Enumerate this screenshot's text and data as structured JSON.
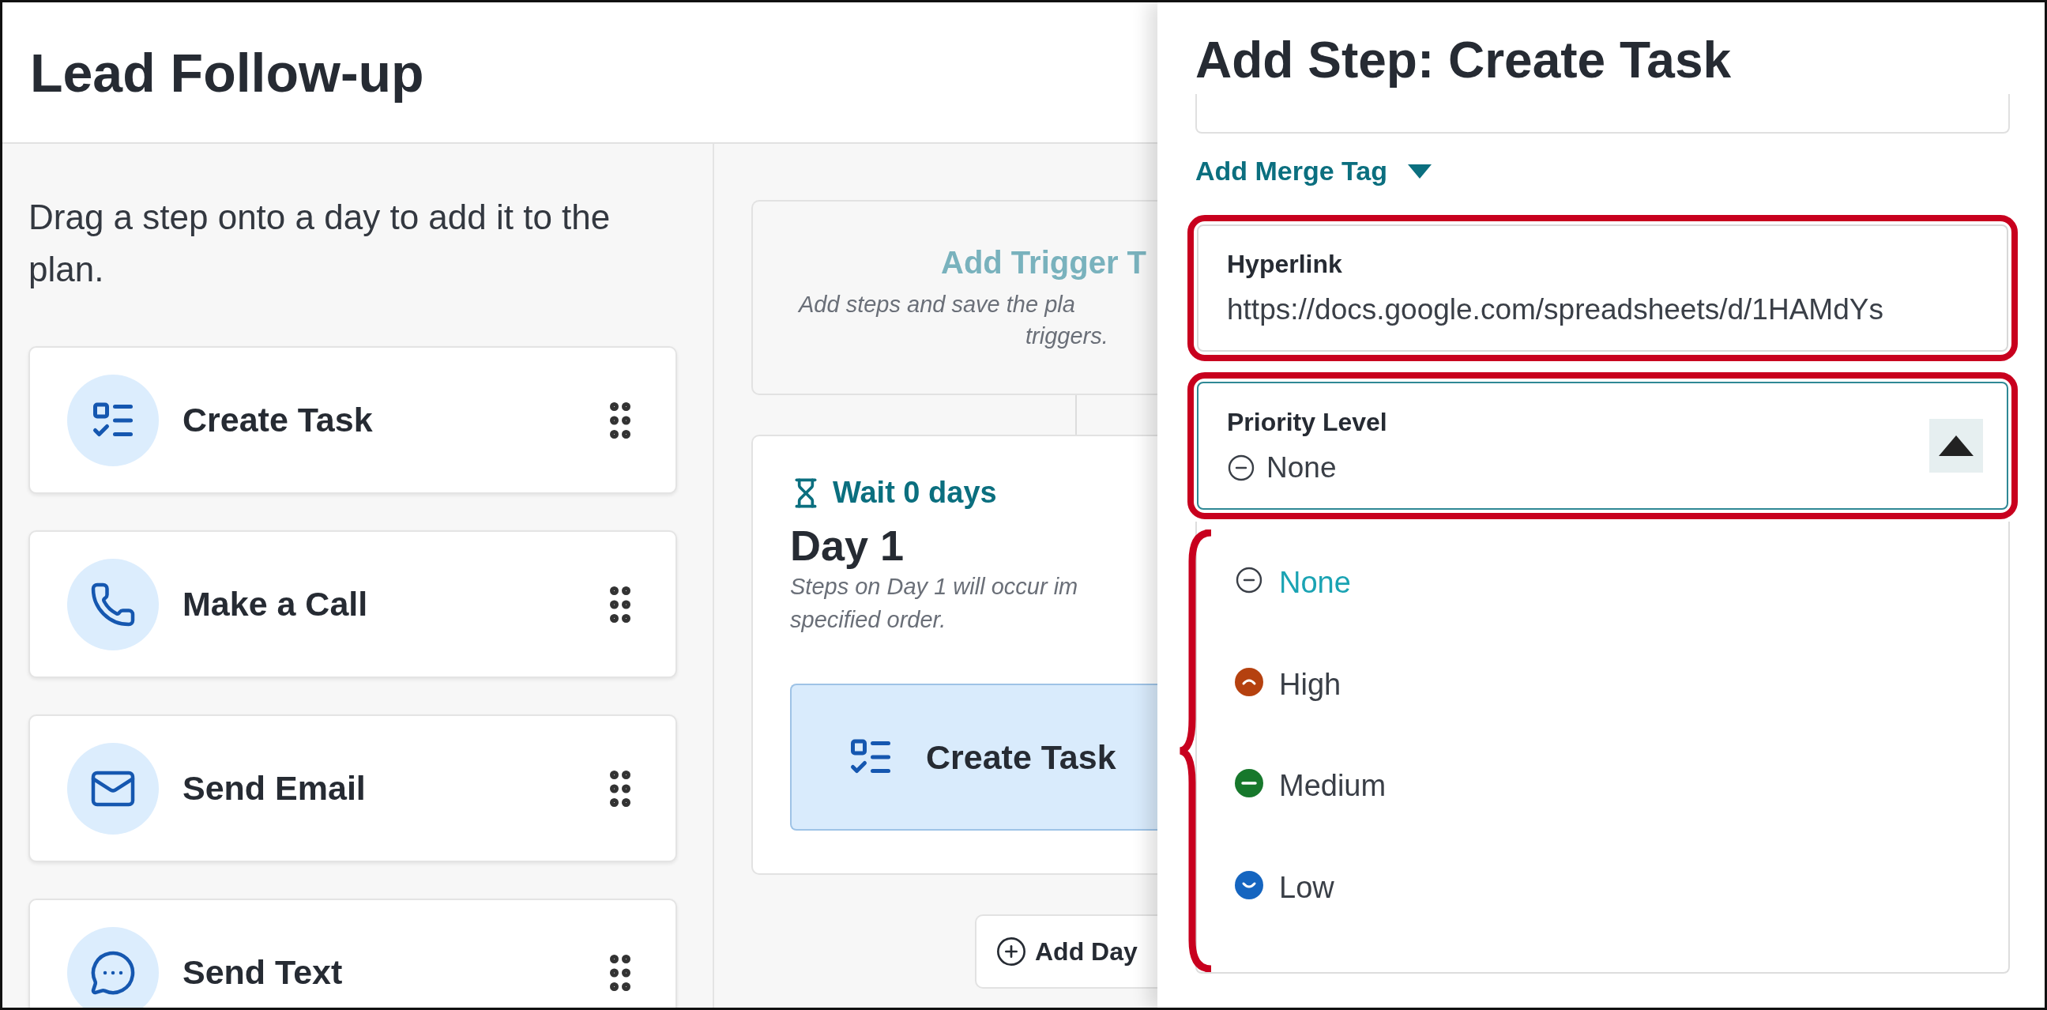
{
  "header": {
    "title": "Lead Follow-up"
  },
  "steps_panel": {
    "hint": "Drag a step onto a day to add it to the plan.",
    "steps": [
      {
        "label": "Create Task",
        "kind": "task"
      },
      {
        "label": "Make a Call",
        "kind": "call"
      },
      {
        "label": "Send Email",
        "kind": "email"
      },
      {
        "label": "Send Text",
        "kind": "text"
      }
    ]
  },
  "plan": {
    "trigger": {
      "title": "Add Trigger T",
      "note_lines": [
        "Add steps and save the pla",
        "triggers."
      ]
    },
    "day": {
      "wait": "Wait 0 days",
      "title": "Day 1",
      "note_lines": [
        "Steps on Day 1 will occur im",
        "specified order."
      ],
      "steps": [
        {
          "label": "Create Task",
          "kind": "task"
        }
      ]
    },
    "add_day": "Add Day"
  },
  "drawer": {
    "title": "Add Step: Create Task",
    "merge_tag": "Add Merge Tag",
    "hyperlink": {
      "label": "Hyperlink",
      "value": "https://docs.google.com/spreadsheets/d/1HAMdYs",
      "highlighted": true
    },
    "priority": {
      "label": "Priority Level",
      "value": "None",
      "expanded": true,
      "highlighted": true,
      "options_bracketed": true,
      "options": [
        {
          "label": "None",
          "kind": "none",
          "selected": true
        },
        {
          "label": "High",
          "kind": "high",
          "color": "#b5410f",
          "selected": false
        },
        {
          "label": "Medium",
          "kind": "medium",
          "color": "#17782c",
          "selected": false
        },
        {
          "label": "Low",
          "kind": "low",
          "color": "#1565c0",
          "selected": false
        }
      ]
    }
  }
}
